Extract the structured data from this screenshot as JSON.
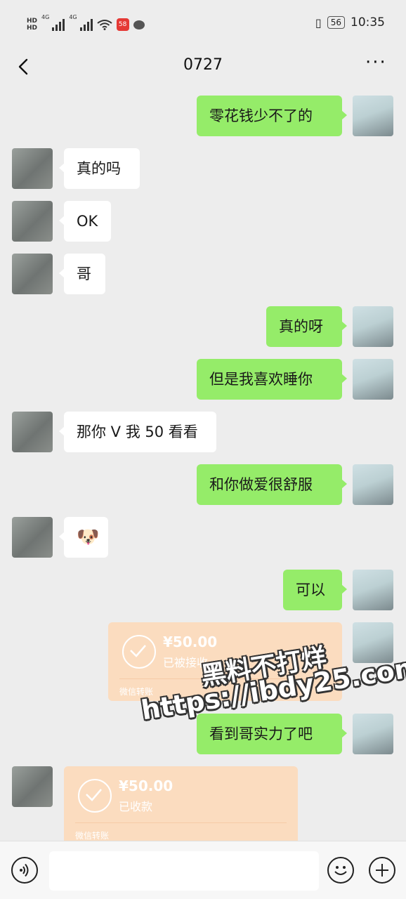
{
  "status_bar": {
    "hd_top": "HD",
    "hd_bottom": "HD",
    "network_1": "4G",
    "network_2": "4G",
    "notif_badge": "58",
    "battery": "56",
    "time": "10:35"
  },
  "header": {
    "title": "0727",
    "back_icon": "chevron-left-icon",
    "more_icon": "more-dots-icon",
    "more_text": "···"
  },
  "messages": [
    {
      "side": "me",
      "text": "零花钱少不了的"
    },
    {
      "side": "her",
      "text": "真的吗"
    },
    {
      "side": "her",
      "text": "OK"
    },
    {
      "side": "her",
      "text": "哥"
    },
    {
      "side": "me",
      "text": "真的呀"
    },
    {
      "side": "me",
      "text": "但是我喜欢睡你"
    },
    {
      "side": "her",
      "text": "那你 V 我 50 看看"
    },
    {
      "side": "me",
      "text": "和你做爱很舒服"
    },
    {
      "side": "her",
      "text": "🐶",
      "type": "emoji"
    },
    {
      "side": "me",
      "text": "可以"
    },
    {
      "side": "me",
      "type": "transfer",
      "amount": "¥50.00",
      "status": "已被接收",
      "footer": "微信转账"
    },
    {
      "side": "me",
      "text": "看到哥实力了吧"
    },
    {
      "side": "her",
      "type": "transfer",
      "amount": "¥50.00",
      "status": "已收款",
      "footer": "微信转账"
    }
  ],
  "watermark": {
    "line1": "黑料不打烊",
    "line2": "https://ibdy25.com"
  },
  "input_bar": {
    "voice_icon": "voice-icon",
    "emoji_icon": "emoji-icon",
    "plus_icon": "plus-icon",
    "input_value": ""
  }
}
